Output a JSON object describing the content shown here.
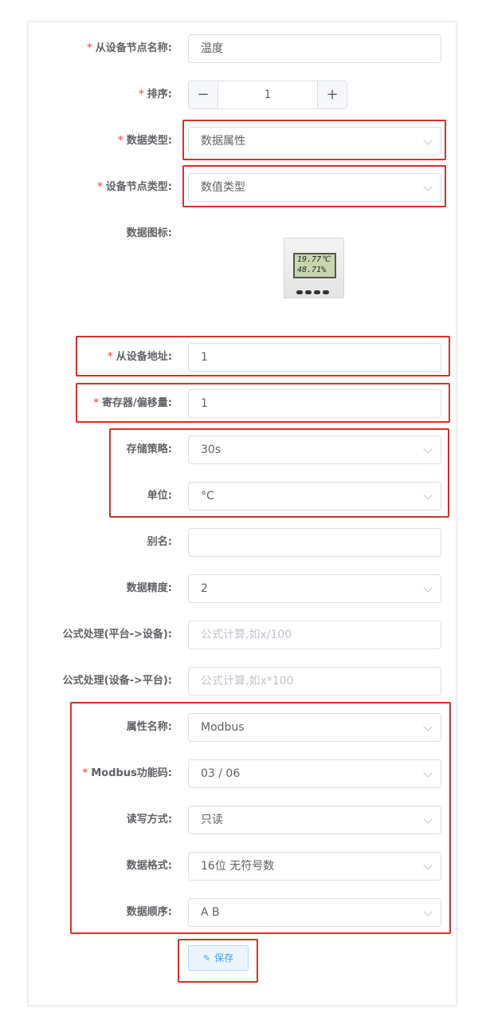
{
  "form": {
    "slave_node_name": {
      "label": "从设备节点名称:",
      "value": "温度",
      "required": true
    },
    "sort": {
      "label": "排序:",
      "value": "1",
      "required": true,
      "minus": "−",
      "plus": "+"
    },
    "data_type": {
      "label": "数据类型:",
      "value": "数据属性",
      "required": true
    },
    "node_type": {
      "label": "设备节点类型:",
      "value": "数值类型",
      "required": true
    },
    "data_icon": {
      "label": "数据图标:",
      "screen_line1": "19.77℃",
      "screen_line2": "48.71%"
    },
    "slave_address": {
      "label": "从设备地址:",
      "value": "1",
      "required": true
    },
    "register_offset": {
      "label": "寄存器/偏移量:",
      "value": "1",
      "required": true
    },
    "storage_policy": {
      "label": "存储策略:",
      "value": "30s"
    },
    "unit": {
      "label": "单位:",
      "value": "°C"
    },
    "alias": {
      "label": "别名:",
      "value": ""
    },
    "precision": {
      "label": "数据精度:",
      "value": "2"
    },
    "formula_to_device": {
      "label": "公式处理(平台->设备):",
      "placeholder": "公式计算,如x/100"
    },
    "formula_to_platform": {
      "label": "公式处理(设备->平台):",
      "placeholder": "公式计算,如x*100"
    },
    "property_name": {
      "label": "属性名称:",
      "value": "Modbus"
    },
    "function_code": {
      "label": "Modbus功能码:",
      "value": "03 / 06",
      "required": true
    },
    "rw_mode": {
      "label": "读写方式:",
      "value": "只读"
    },
    "data_format": {
      "label": "数据格式:",
      "value": "16位 无符号数"
    },
    "data_order": {
      "label": "数据顺序:",
      "value": "A B"
    },
    "required_mark": "*"
  },
  "actions": {
    "save_label": "保存",
    "save_icon": "edit-icon"
  },
  "colors": {
    "required": "#f56c6c",
    "highlight": "#d93025",
    "primary": "#409eff"
  }
}
